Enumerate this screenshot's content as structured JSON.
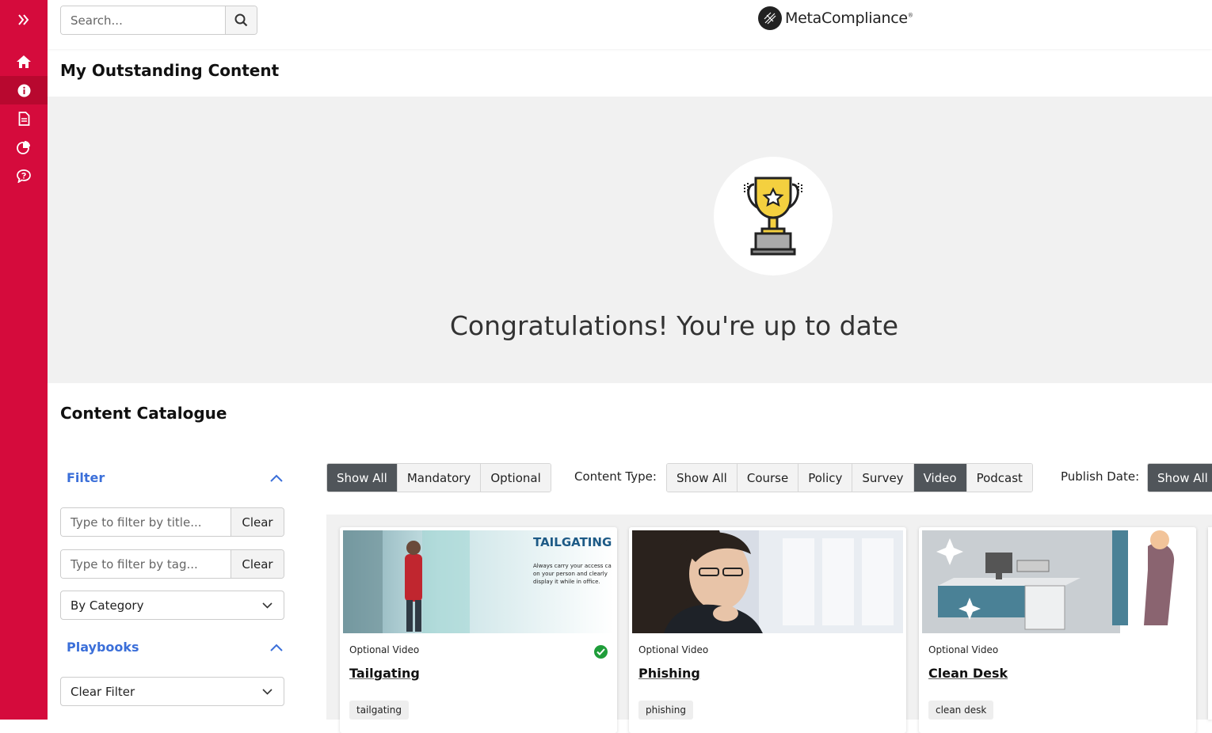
{
  "header": {
    "search_placeholder": "Search...",
    "logo_text": "MetaCompliance"
  },
  "sidebar": {
    "items": [
      {
        "icon": "double-chevron-right-icon"
      },
      {
        "icon": "home-icon"
      },
      {
        "icon": "info-icon",
        "active": true
      },
      {
        "icon": "document-icon"
      },
      {
        "icon": "pie-chart-icon"
      },
      {
        "icon": "chat-question-icon"
      }
    ]
  },
  "outstanding": {
    "title": "My Outstanding Content",
    "message": "Congratulations! You're up to date"
  },
  "catalogue": {
    "title": "Content Catalogue",
    "filter": {
      "label": "Filter",
      "title_placeholder": "Type to filter by title...",
      "tag_placeholder": "Type to filter by tag...",
      "clear_label": "Clear",
      "category_select": "By Category"
    },
    "playbooks": {
      "label": "Playbooks",
      "select": "Clear Filter"
    },
    "requirement_buttons": [
      "Show All",
      "Mandatory",
      "Optional"
    ],
    "content_type_label": "Content Type:",
    "content_type_buttons": [
      "Show All",
      "Course",
      "Policy",
      "Survey",
      "Video",
      "Podcast"
    ],
    "publish_date_label": "Publish Date:",
    "publish_date_buttons": [
      "Show All"
    ],
    "cards": [
      {
        "type": "Optional Video",
        "title": "Tailgating",
        "tag": "tailgating",
        "completed": true,
        "image_heading": "TAILGATING",
        "image_caption": "Always carry your access ca on your person and clearly display it while in office."
      },
      {
        "type": "Optional Video",
        "title": "Phishing",
        "tag": "phishing",
        "completed": false
      },
      {
        "type": "Optional Video",
        "title": "Clean Desk",
        "tag": "clean desk",
        "completed": false
      }
    ]
  },
  "colors": {
    "sidebar": "#d50b3c",
    "accent_blue": "#3b6fd9",
    "active_button": "#50555a",
    "success": "#1f9d3a"
  }
}
